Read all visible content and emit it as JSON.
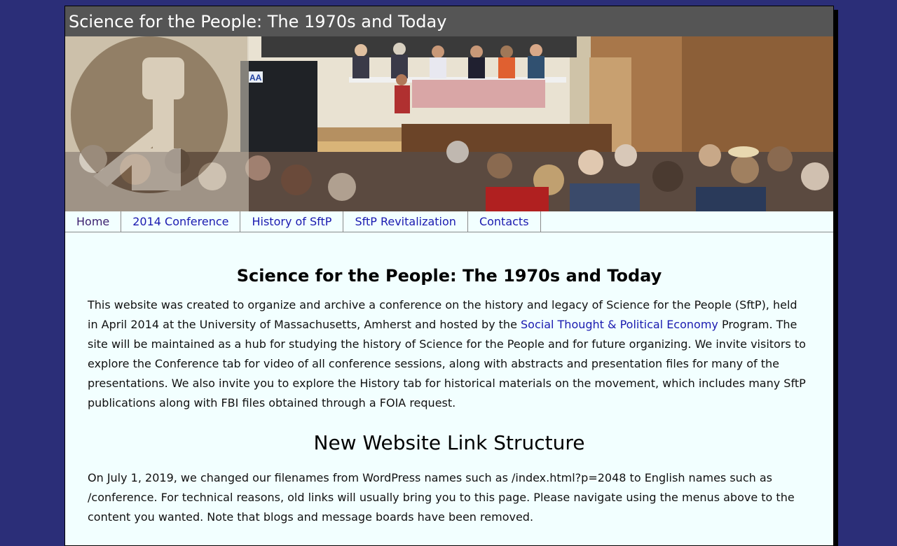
{
  "site": {
    "title": "Science for the People: The 1970s and Today"
  },
  "banner": {
    "alt": "Conference panel photograph with raised fist logo",
    "sign_text": "AA"
  },
  "nav": {
    "items": [
      {
        "label": "Home",
        "current": true
      },
      {
        "label": "2014 Conference",
        "current": false
      },
      {
        "label": "History of SftP",
        "current": false
      },
      {
        "label": "SftP Revitalization",
        "current": false
      },
      {
        "label": "Contacts",
        "current": false
      }
    ]
  },
  "main": {
    "heading": "Science for the People: The 1970s and Today",
    "intro_before_link": "This website was created to organize and archive a conference on the history and legacy of Science for the People (SftP), held in April 2014 at the University of Massachusetts, Amherst and hosted by the ",
    "intro_link": "Social Thought & Political Economy",
    "intro_after_link": " Program. The site will be maintained as a hub for studying the history of Science for the People and for future organizing. We invite visitors to explore the Conference tab for video of all conference sessions, along with abstracts and presentation files for many of the presentations. We also invite you to explore the History tab for historical materials on the movement, which includes many SftP publications along with FBI files obtained through a FOIA request.",
    "section_heading": "New Website Link Structure",
    "link_structure_text": "On July 1, 2019, we changed our filenames from WordPress names such as /index.html?p=2048 to English names such as /conference. For technical reasons, old links will usually bring you to this page. Please navigate using the menus above to the content you wanted. Note that blogs and message boards have been removed."
  },
  "colors": {
    "background": "#2b2e78",
    "page": "#f2ffff",
    "title_bar": "#555555",
    "link": "#1a1ab0"
  }
}
